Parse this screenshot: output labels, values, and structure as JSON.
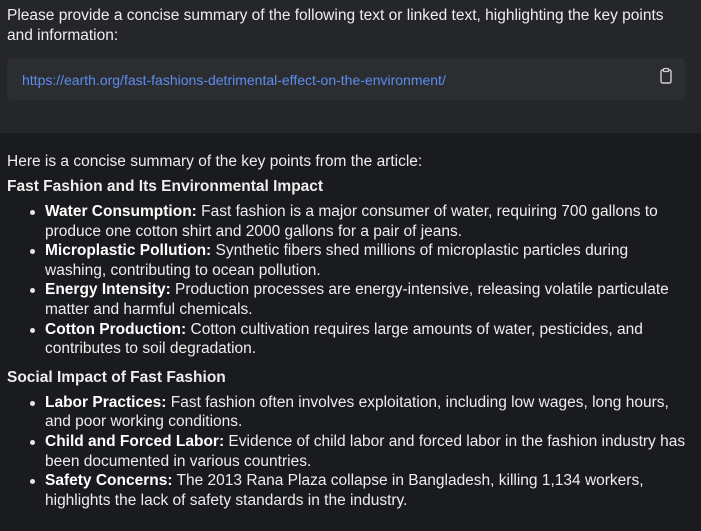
{
  "prompt": {
    "text": "Please provide a concise summary of the following text or linked text, highlighting the key points and information:",
    "link": "https://earth.org/fast-fashions-detrimental-effect-on-the-environment/",
    "copy_icon": "clipboard-icon"
  },
  "response": {
    "intro": "Here is a concise summary of the key points from the article:",
    "sections": [
      {
        "title": "Fast Fashion and Its Environmental Impact",
        "items": [
          {
            "label": "Water Consumption:",
            "text": " Fast fashion is a major consumer of water, requiring 700 gallons to produce one cotton shirt and 2000 gallons for a pair of jeans."
          },
          {
            "label": "Microplastic Pollution:",
            "text": " Synthetic fibers shed millions of microplastic particles during washing, contributing to ocean pollution."
          },
          {
            "label": "Energy Intensity:",
            "text": " Production processes are energy-intensive, releasing volatile particulate matter and harmful chemicals."
          },
          {
            "label": "Cotton Production:",
            "text": " Cotton cultivation requires large amounts of water, pesticides, and contributes to soil degradation."
          }
        ]
      },
      {
        "title": "Social Impact of Fast Fashion",
        "items": [
          {
            "label": "Labor Practices:",
            "text": " Fast fashion often involves exploitation, including low wages, long hours, and poor working conditions."
          },
          {
            "label": "Child and Forced Labor:",
            "text": " Evidence of child labor and forced labor in the fashion industry has been documented in various countries."
          },
          {
            "label": "Safety Concerns:",
            "text": " The 2013 Rana Plaza collapse in Bangladesh, killing 1,134 workers, highlights the lack of safety standards in the industry."
          }
        ]
      }
    ]
  }
}
